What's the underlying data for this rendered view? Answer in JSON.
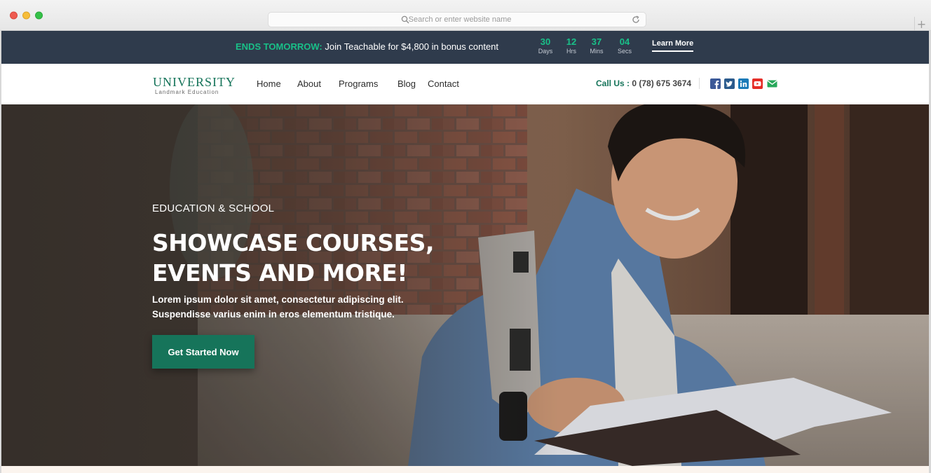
{
  "browser": {
    "url_placeholder": "Search or enter website name",
    "new_tab_symbol": "+"
  },
  "announcement": {
    "accent": "ENDS TOMORROW:",
    "text": " Join Teachable for $4,800 in bonus content",
    "countdown": [
      {
        "value": "30",
        "label": "Days"
      },
      {
        "value": "12",
        "label": "Hrs"
      },
      {
        "value": "37",
        "label": "Mins"
      },
      {
        "value": "04",
        "label": "Secs"
      }
    ],
    "cta": "Learn More"
  },
  "nav": {
    "logo_title": "UNIVERSITY",
    "logo_subtitle": "Landmark Education",
    "links": [
      "Home",
      "About",
      "Programs",
      "Blog",
      "Contact"
    ],
    "call_label": "Call Us :",
    "call_number": " 0 (78) 675 3674",
    "social": [
      "facebook-icon",
      "twitter-icon",
      "linkedin-icon",
      "youtube-icon",
      "email-icon"
    ]
  },
  "hero": {
    "eyebrow": "EDUCATION & SCHOOL",
    "title_line1": "SHOWCASE COURSES,",
    "title_line2": "EVENTS AND MORE!",
    "desc_line1": "Lorem ipsum dolor sit amet, consectetur adipiscing elit.",
    "desc_line2": "Suspendisse varius enim in eros elementum tristique.",
    "cta": "Get Started Now"
  },
  "colors": {
    "brand_green": "#16745a",
    "accent_green": "#19c088",
    "announce_bg": "#2f3b4c"
  }
}
